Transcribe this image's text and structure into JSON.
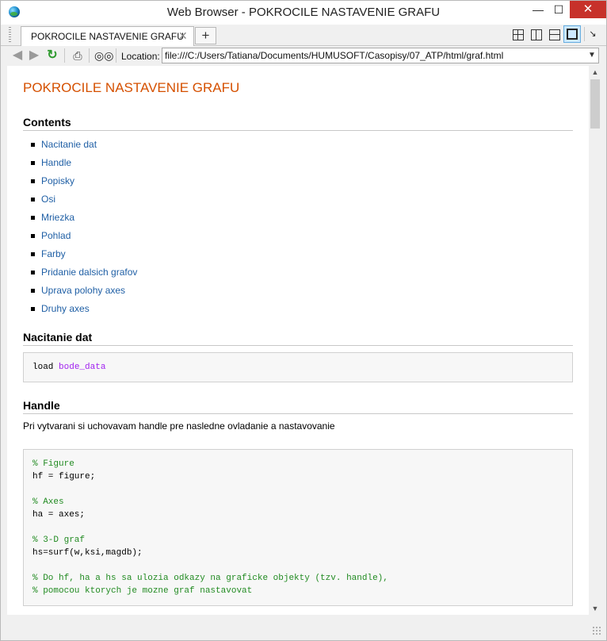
{
  "window": {
    "title": "Web Browser - POKROCILE NASTAVENIE GRAFU",
    "controls": {
      "minimize": "—",
      "maximize": "☐",
      "close": "✕"
    }
  },
  "tabs": [
    {
      "label": "POKROCILE NASTAVENIE GRAFU",
      "close": "✕",
      "active": true
    }
  ],
  "tab_add": "+",
  "toolbar": {
    "back_icon": "arrow-left-icon",
    "forward_icon": "arrow-right-icon",
    "refresh_icon": "refresh-icon",
    "print_icon": "print-icon",
    "find_icon": "binoculars-icon",
    "location_label": "Location:",
    "location_value": "file:///C:/Users/Tatiana/Documents/HUMUSOFT/Casopisy/07_ATP/html/graf.html"
  },
  "page": {
    "title": "POKROCILE NASTAVENIE GRAFU",
    "contents_heading": "Contents",
    "toc": [
      "Nacitanie dat",
      "Handle",
      "Popisky",
      "Osi",
      "Mriezka",
      "Pohlad",
      "Farby",
      "Pridanie dalsich grafov",
      "Uprava polohy axes",
      "Druhy axes"
    ],
    "section1": {
      "heading": "Nacitanie dat",
      "code_cmd": "load ",
      "code_arg": "bode_data"
    },
    "section2": {
      "heading": "Handle",
      "text": "Pri vytvarani si uchovavam handle pre nasledne ovladanie a nastavovanie",
      "code": [
        {
          "text": "% Figure",
          "comment": true
        },
        {
          "text": "hf = figure;",
          "comment": false
        },
        {
          "text": "",
          "comment": false
        },
        {
          "text": "% Axes",
          "comment": true
        },
        {
          "text": "ha = axes;",
          "comment": false
        },
        {
          "text": "",
          "comment": false
        },
        {
          "text": "% 3-D graf",
          "comment": true
        },
        {
          "text": "hs=surf(w,ksi,magdb);",
          "comment": false
        },
        {
          "text": "",
          "comment": false
        },
        {
          "text": "% Do hf, ha a hs sa ulozia odkazy na graficke objekty (tzv. handle),",
          "comment": true
        },
        {
          "text": "% pomocou ktorych je mozne graf nastavovat",
          "comment": true
        }
      ]
    }
  },
  "colors": {
    "title": "#d55000",
    "link": "#1f5fa5",
    "comment": "#228b22",
    "string": "#a020f0",
    "close_button": "#c7312a"
  }
}
